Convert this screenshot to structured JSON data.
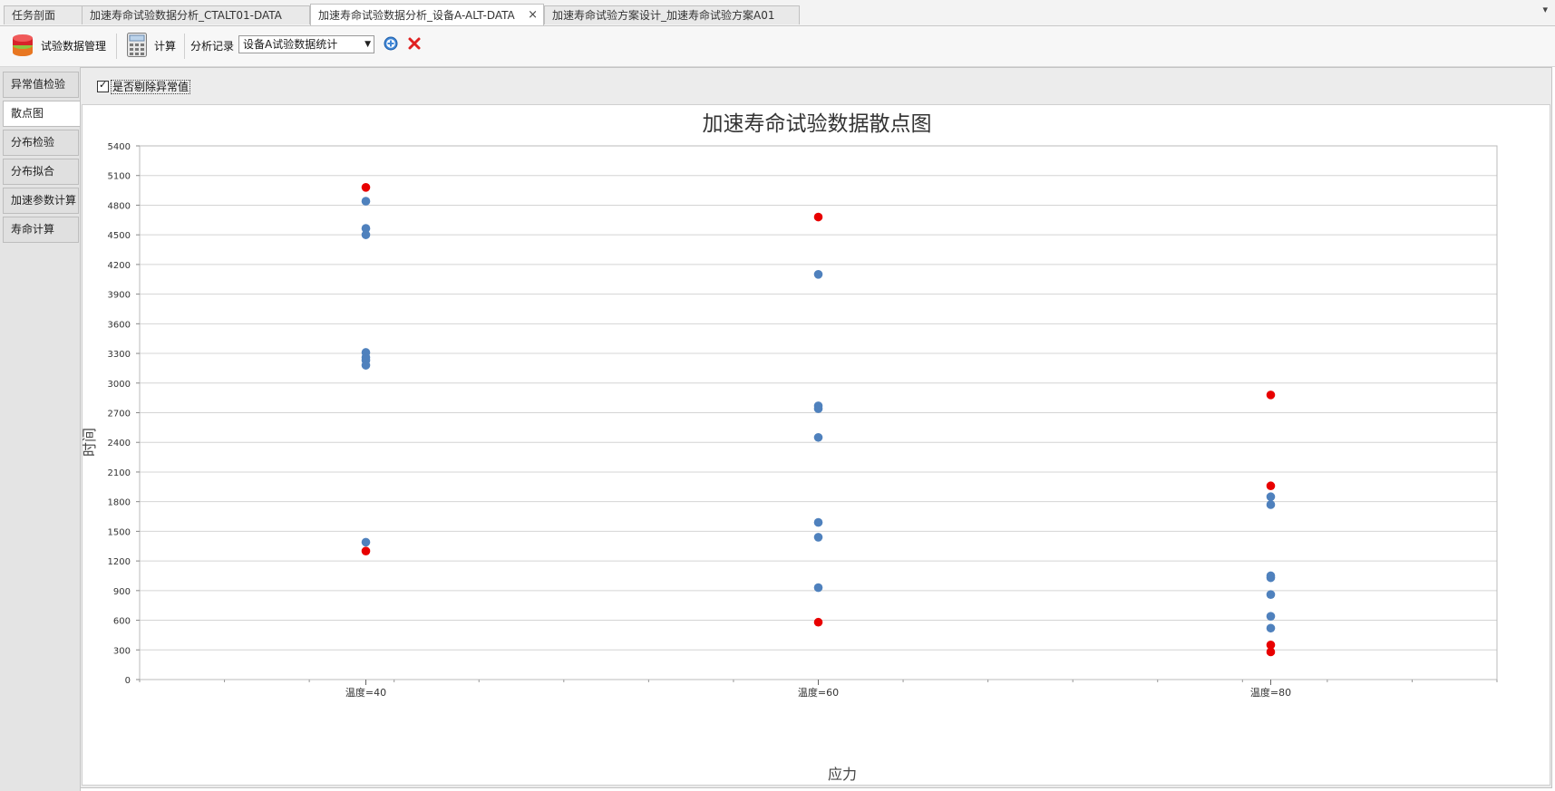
{
  "tabs": [
    {
      "label": "任务剖面",
      "active": false
    },
    {
      "label": "加速寿命试验数据分析_CTALT01-DATA",
      "active": false
    },
    {
      "label": "加速寿命试验数据分析_设备A-ALT-DATA",
      "active": true,
      "close": "×"
    },
    {
      "label": "加速寿命试验方案设计_加速寿命试验方案A01",
      "active": false
    }
  ],
  "tab_menu_icon": "▾",
  "toolbar": {
    "data_manage_label": "试验数据管理",
    "calc_label": "计算",
    "record_label": "分析记录",
    "record_value": "设备A试验数据统计",
    "icons": [
      "database-icon",
      "calculator-icon",
      "add-icon",
      "delete-icon"
    ]
  },
  "sidenav": [
    {
      "label": "异常值检验",
      "active": false
    },
    {
      "label": "散点图",
      "active": true
    },
    {
      "label": "分布检验",
      "active": false
    },
    {
      "label": "分布拟合",
      "active": false
    },
    {
      "label": "加速参数计算",
      "active": false
    },
    {
      "label": "寿命计算",
      "active": false
    }
  ],
  "filter": {
    "checkbox_label": "是否剔除异常值",
    "checked": true
  },
  "colors": {
    "normal": "#4f81bd",
    "outlier": "#e80000"
  },
  "chart_data": {
    "type": "scatter",
    "title": "加速寿命试验数据散点图",
    "xlabel": "应力",
    "ylabel": "时间",
    "categories": [
      "温度=40",
      "温度=60",
      "温度=80"
    ],
    "ylim": [
      0,
      5400
    ],
    "yticks": [
      0,
      300,
      600,
      900,
      1200,
      1500,
      1800,
      2100,
      2400,
      2700,
      3000,
      3300,
      3600,
      3900,
      4200,
      4500,
      4800,
      5100,
      5400
    ],
    "grid": true,
    "legend": "none",
    "series": [
      {
        "values": [
          {
            "x": "温度=40",
            "y": 4840
          },
          {
            "x": "温度=40",
            "y": 4565
          },
          {
            "x": "温度=40",
            "y": 4500
          },
          {
            "x": "温度=40",
            "y": 3310
          },
          {
            "x": "温度=40",
            "y": 3260
          },
          {
            "x": "温度=40",
            "y": 3230
          },
          {
            "x": "温度=40",
            "y": 3180
          },
          {
            "x": "温度=40",
            "y": 1390
          },
          {
            "x": "温度=60",
            "y": 4100
          },
          {
            "x": "温度=60",
            "y": 2770
          },
          {
            "x": "温度=60",
            "y": 2740
          },
          {
            "x": "温度=60",
            "y": 2450
          },
          {
            "x": "温度=60",
            "y": 1590
          },
          {
            "x": "温度=60",
            "y": 1440
          },
          {
            "x": "温度=60",
            "y": 930
          },
          {
            "x": "温度=80",
            "y": 1850
          },
          {
            "x": "温度=80",
            "y": 1770
          },
          {
            "x": "温度=80",
            "y": 1050
          },
          {
            "x": "温度=80",
            "y": 1030
          },
          {
            "x": "温度=80",
            "y": 860
          },
          {
            "x": "温度=80",
            "y": 640
          },
          {
            "x": "温度=80",
            "y": 520
          }
        ]
      },
      {
        "values": [
          {
            "x": "温度=40",
            "y": 4980
          },
          {
            "x": "温度=40",
            "y": 1300
          },
          {
            "x": "温度=60",
            "y": 4680
          },
          {
            "x": "温度=60",
            "y": 580
          },
          {
            "x": "温度=80",
            "y": 2880
          },
          {
            "x": "温度=80",
            "y": 1960
          },
          {
            "x": "温度=80",
            "y": 350
          },
          {
            "x": "温度=80",
            "y": 280
          }
        ]
      }
    ]
  }
}
